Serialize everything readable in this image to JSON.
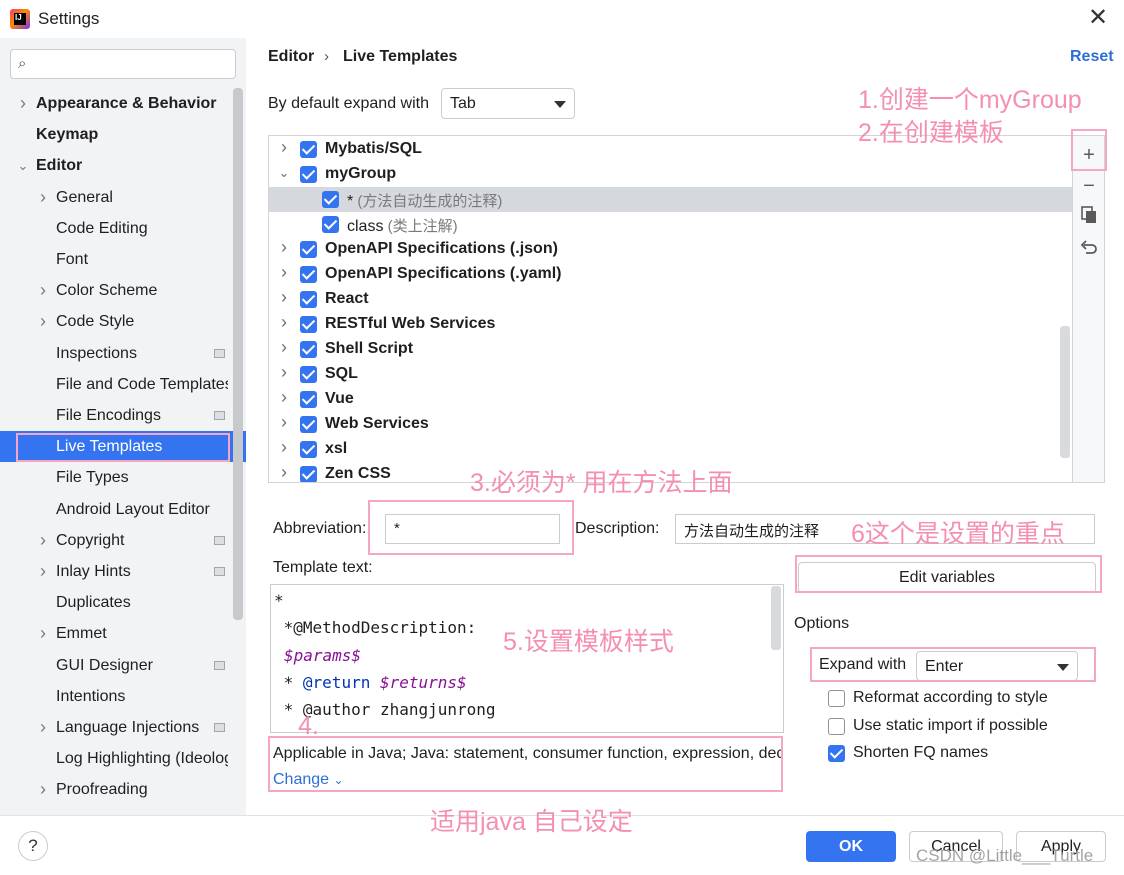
{
  "window": {
    "title": "Settings",
    "close": "✕"
  },
  "sidebar": {
    "search_icon": "search-icon",
    "items": [
      {
        "label": "Appearance & Behavior",
        "bold": true,
        "expander": "right",
        "level": 0
      },
      {
        "label": "Keymap",
        "bold": true,
        "expander": "",
        "level": 0
      },
      {
        "label": "Editor",
        "bold": true,
        "expander": "down",
        "level": 0
      },
      {
        "label": "General",
        "expander": "right",
        "level": 1
      },
      {
        "label": "Code Editing",
        "expander": "",
        "level": 1
      },
      {
        "label": "Font",
        "expander": "",
        "level": 1
      },
      {
        "label": "Color Scheme",
        "expander": "right",
        "level": 1
      },
      {
        "label": "Code Style",
        "expander": "right",
        "level": 1
      },
      {
        "label": "Inspections",
        "expander": "",
        "level": 1,
        "mark": true
      },
      {
        "label": "File and Code Templates",
        "expander": "",
        "level": 1
      },
      {
        "label": "File Encodings",
        "expander": "",
        "level": 1,
        "mark": true
      },
      {
        "label": "Live Templates",
        "expander": "",
        "level": 1,
        "selected": true
      },
      {
        "label": "File Types",
        "expander": "",
        "level": 1
      },
      {
        "label": "Android Layout Editor",
        "expander": "",
        "level": 1
      },
      {
        "label": "Copyright",
        "expander": "right",
        "level": 1,
        "mark": true
      },
      {
        "label": "Inlay Hints",
        "expander": "right",
        "level": 1,
        "mark": true
      },
      {
        "label": "Duplicates",
        "expander": "",
        "level": 1
      },
      {
        "label": "Emmet",
        "expander": "right",
        "level": 1
      },
      {
        "label": "GUI Designer",
        "expander": "",
        "level": 1,
        "mark": true
      },
      {
        "label": "Intentions",
        "expander": "",
        "level": 1
      },
      {
        "label": "Language Injections",
        "expander": "right",
        "level": 1,
        "mark": true
      },
      {
        "label": "Log Highlighting (Ideolog)",
        "expander": "",
        "level": 1
      },
      {
        "label": "Proofreading",
        "expander": "right",
        "level": 1
      }
    ]
  },
  "breadcrumb": {
    "root": "Editor",
    "current": "Live Templates",
    "reset": "Reset"
  },
  "expand_default": {
    "label": "By default expand with",
    "value": "Tab"
  },
  "templates": [
    {
      "name": "Mybatis/SQL",
      "group": true,
      "expander": "right",
      "checked": true
    },
    {
      "name": "myGroup",
      "group": true,
      "expander": "down",
      "checked": true
    },
    {
      "name": "*",
      "desc": "(方法自动生成的注释)",
      "group": false,
      "checked": true,
      "selected": true
    },
    {
      "name": "class",
      "desc": "(类上注解)",
      "group": false,
      "checked": true
    },
    {
      "name": "OpenAPI Specifications (.json)",
      "group": true,
      "expander": "right",
      "checked": true
    },
    {
      "name": "OpenAPI Specifications (.yaml)",
      "group": true,
      "expander": "right",
      "checked": true
    },
    {
      "name": "React",
      "group": true,
      "expander": "right",
      "checked": true
    },
    {
      "name": "RESTful Web Services",
      "group": true,
      "expander": "right",
      "checked": true
    },
    {
      "name": "Shell Script",
      "group": true,
      "expander": "right",
      "checked": true
    },
    {
      "name": "SQL",
      "group": true,
      "expander": "right",
      "checked": true
    },
    {
      "name": "Vue",
      "group": true,
      "expander": "right",
      "checked": true
    },
    {
      "name": "Web Services",
      "group": true,
      "expander": "right",
      "checked": true
    },
    {
      "name": "xsl",
      "group": true,
      "expander": "right",
      "checked": true
    },
    {
      "name": "Zen CSS",
      "group": true,
      "expander": "right",
      "checked": true
    }
  ],
  "toolbar": {
    "add": "+",
    "remove": "−",
    "copy_icon": "copy-icon",
    "restore_icon": "restore-icon"
  },
  "abbreviation": {
    "label": "Abbreviation:",
    "value": "*"
  },
  "description": {
    "label": "Description:",
    "value": "方法自动生成的注释"
  },
  "template_text": {
    "label": "Template text:",
    "lines": [
      {
        "parts": [
          {
            "t": "*",
            "c": "plain"
          }
        ]
      },
      {
        "parts": [
          {
            "t": " *@MethodDescription:",
            "c": "plain"
          }
        ]
      },
      {
        "parts": [
          {
            "t": "$params$",
            "c": "var"
          }
        ]
      },
      {
        "parts": [
          {
            "t": " * ",
            "c": "plain"
          },
          {
            "t": "@return",
            "c": "kw"
          },
          {
            "t": " ",
            "c": "plain"
          },
          {
            "t": "$returns$",
            "c": "var"
          }
        ]
      },
      {
        "parts": [
          {
            "t": " * @author zhangjunrong",
            "c": "plain"
          }
        ]
      }
    ]
  },
  "applicable": {
    "text": "Applicable in Java; Java: statement, consumer function, expression, declaration.",
    "change": "Change"
  },
  "edit_variables": "Edit variables",
  "options": {
    "label": "Options",
    "expand_label": "Expand with",
    "expand_value": "Enter",
    "checks": [
      {
        "label": "Reformat according to style",
        "checked": false
      },
      {
        "label": "Use static import if possible",
        "checked": false
      },
      {
        "label": "Shorten FQ names",
        "checked": true
      }
    ]
  },
  "buttons": {
    "help": "?",
    "ok": "OK",
    "cancel": "Cancel",
    "apply": "Apply"
  },
  "annotations": {
    "a1": "1.创建一个myGroup",
    "a2": "2.在创建模板",
    "a3": "3.必须为*    用在方法上面",
    "a4": "4.",
    "a5": "5.设置模板样式",
    "a6": "6这个是设置的重点",
    "a7": "适用java 自己设定"
  },
  "watermark": "CSDN @Little___Turtle",
  "colors": {
    "accent": "#3574f0",
    "annotation": "#f48fb1",
    "link": "#2f6fd6"
  }
}
